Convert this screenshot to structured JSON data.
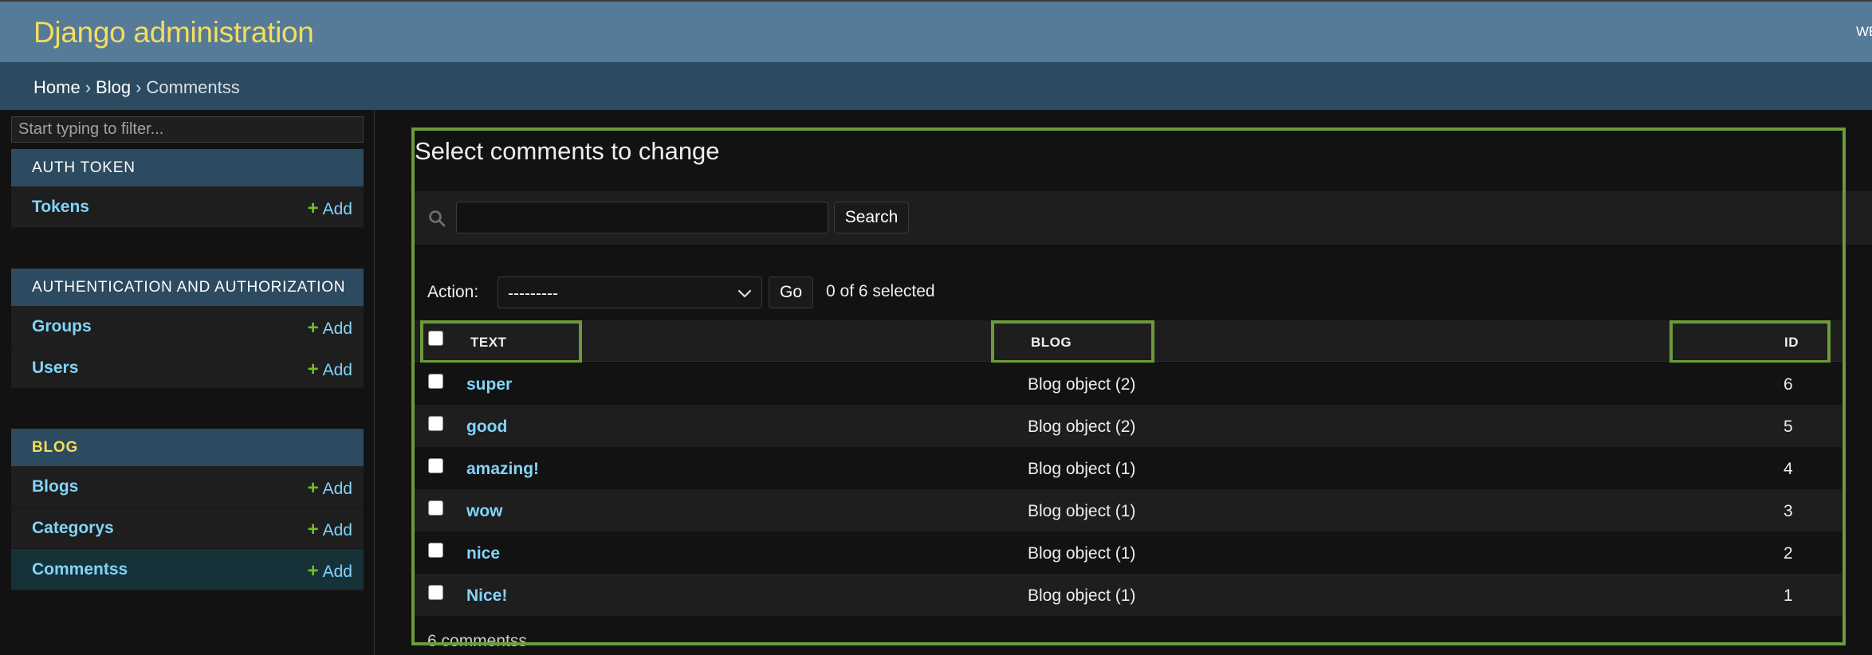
{
  "header": {
    "site_name": "Django administration",
    "user_tools_fragment": "WE"
  },
  "breadcrumbs": [
    "Home",
    "Blog",
    "Commentss"
  ],
  "breadcrumb_separator": "›",
  "sidebar": {
    "filter_placeholder": "Start typing to filter...",
    "modules": [
      {
        "caption": "AUTH TOKEN",
        "models": [
          {
            "name": "Tokens",
            "add_label": "Add"
          }
        ]
      },
      {
        "caption": "AUTHENTICATION AND AUTHORIZATION",
        "models": [
          {
            "name": "Groups",
            "add_label": "Add"
          },
          {
            "name": "Users",
            "add_label": "Add"
          }
        ]
      },
      {
        "caption": "BLOG",
        "active": true,
        "models": [
          {
            "name": "Blogs",
            "add_label": "Add"
          },
          {
            "name": "Categorys",
            "add_label": "Add"
          },
          {
            "name": "Commentss",
            "add_label": "Add",
            "current": true
          }
        ]
      }
    ]
  },
  "content": {
    "title": "Select comments to change",
    "search": {
      "value": "",
      "button_label": "Search"
    },
    "actions": {
      "label": "Action:",
      "selected_option": "---------",
      "go_label": "Go",
      "counter": "0 of 6 selected"
    },
    "table": {
      "columns": [
        "TEXT",
        "BLOG",
        "ID"
      ],
      "rows": [
        {
          "text": "super",
          "blog": "Blog object (2)",
          "id": "6"
        },
        {
          "text": "good",
          "blog": "Blog object (2)",
          "id": "5"
        },
        {
          "text": "amazing!",
          "blog": "Blog object (1)",
          "id": "4"
        },
        {
          "text": "wow",
          "blog": "Blog object (1)",
          "id": "3"
        },
        {
          "text": "nice",
          "blog": "Blog object (1)",
          "id": "2"
        },
        {
          "text": "Nice!",
          "blog": "Blog object (1)",
          "id": "1"
        }
      ]
    },
    "paginator": "6 commentss"
  },
  "colors": {
    "header_bg": "#567b99",
    "site_name": "#f5dd5d",
    "breadcrumbs_bg": "#2c4a60",
    "link": "#81d4fa",
    "add_plus": "#70bf2b",
    "highlight_box": "#6d9a3a",
    "page_bg": "#121212"
  },
  "icons": {
    "search": "search-icon",
    "plus": "plus-icon",
    "chevron": "chevron-down-icon"
  }
}
